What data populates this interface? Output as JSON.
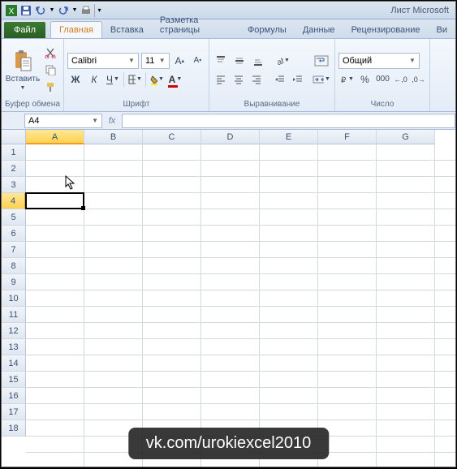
{
  "title": "Лист Microsoft",
  "tabs": {
    "file": "Файл",
    "home": "Главная",
    "insert": "Вставка",
    "pagelayout": "Разметка страницы",
    "formulas": "Формулы",
    "data": "Данные",
    "review": "Рецензирование",
    "view": "Ви"
  },
  "clipboard": {
    "paste": "Вставить",
    "label": "Буфер обмена"
  },
  "font": {
    "name": "Calibri",
    "size": "11",
    "label": "Шрифт"
  },
  "alignment": {
    "label": "Выравнивание"
  },
  "number": {
    "format": "Общий",
    "label": "Число"
  },
  "namebox": "A4",
  "columns": [
    "A",
    "B",
    "C",
    "D",
    "E",
    "F",
    "G"
  ],
  "rows": [
    "1",
    "2",
    "3",
    "4",
    "5",
    "6",
    "7",
    "8",
    "9",
    "10",
    "11",
    "12",
    "13",
    "14",
    "15",
    "16",
    "17",
    "18"
  ],
  "selected_col": 0,
  "selected_row": 3,
  "watermark": "vk.com/urokiexcel2010"
}
